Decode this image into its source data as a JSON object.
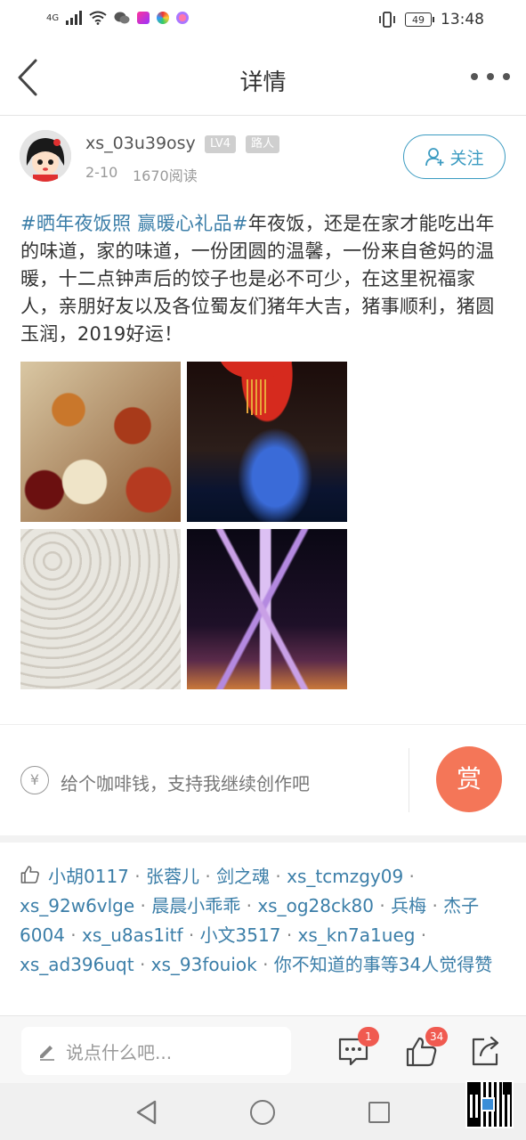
{
  "status_bar": {
    "network": "4G",
    "battery": "49",
    "time": "13:48"
  },
  "header": {
    "title": "详情"
  },
  "author": {
    "name": "xs_03u39osy",
    "level": "LV4",
    "role": "路人",
    "date": "2-10",
    "reads": "1670阅读",
    "follow_label": "关注"
  },
  "post": {
    "tags": [
      "#晒年夜饭照",
      "赢暖心礼品#"
    ],
    "body": "年夜饭，还是在家才能吃出年的味道，家的味道，一份团圆的温馨，一份来自爸妈的温暖，十二点钟声后的饺子也是必不可少，在这里祝福家人，亲朋好友以及各位蜀友们猪年大吉，猪事顺利，猪圆玉润，2019好运！"
  },
  "tip": {
    "text": "给个咖啡钱，支持我继续创作吧",
    "reward_label": "赏",
    "currency_symbol": "¥"
  },
  "likes": {
    "users": [
      "小胡0117",
      "张蓉儿",
      "剑之魂",
      "xs_tcmzgy09",
      "xs_92w6vlge",
      "晨晨小乖乖",
      "xs_og28ck80",
      "兵梅",
      "杰子6004",
      "xs_u8as1itf",
      "小文3517",
      "xs_kn7a1ueg",
      "xs_ad396uqt",
      "xs_93fouiok",
      "你不知道的事"
    ],
    "separator": " · ",
    "summary": "等34人觉得赞"
  },
  "bottom_bar": {
    "comment_placeholder": "说点什么吧...",
    "comment_count": "1",
    "like_count": "34"
  },
  "colors": {
    "accent": "#3b9bc1",
    "tag": "#3b7ea8",
    "reward": "#f47658",
    "badge": "#f05a50"
  }
}
